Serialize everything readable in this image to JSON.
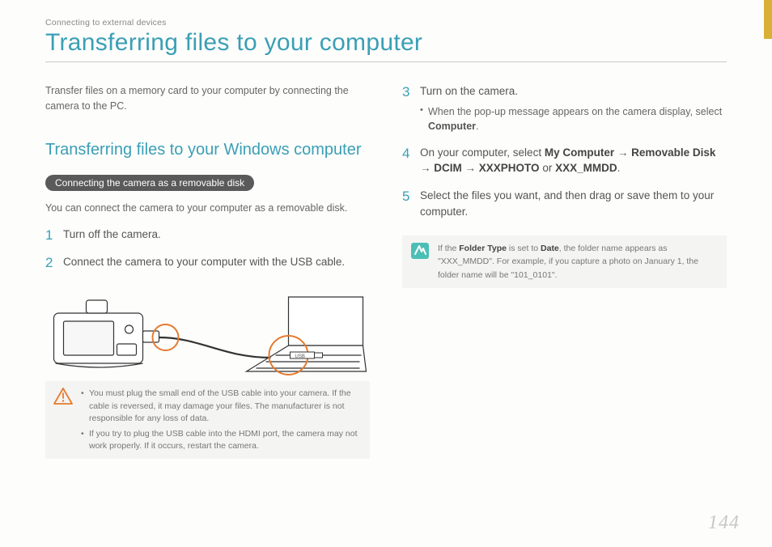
{
  "breadcrumb": "Connecting to external devices",
  "title": "Transferring files to your computer",
  "intro": "Transfer files on a memory card to your computer by connecting the camera to the PC.",
  "section_heading": "Transferring files to your Windows computer",
  "pill": "Connecting the camera as a removable disk",
  "lead": "You can connect the camera to your computer as a removable disk.",
  "steps": {
    "s1": {
      "num": "1",
      "text": "Turn off the camera."
    },
    "s2": {
      "num": "2",
      "text": "Connect the camera to your computer with the USB cable."
    },
    "s3": {
      "num": "3",
      "text": "Turn on the camera.",
      "sub_prefix": "When the pop-up message appears on the camera display, select ",
      "sub_bold": "Computer",
      "sub_suffix": "."
    },
    "s4": {
      "num": "4",
      "prefix": "On your computer, select ",
      "b1": "My Computer",
      "arrow1": " → ",
      "b2": "Removable Disk",
      "arrow2": " → ",
      "b3": "DCIM",
      "arrow3": " → ",
      "b4": "XXXPHOTO",
      "or": " or ",
      "b5": "XXX_MMDD",
      "suffix": "."
    },
    "s5": {
      "num": "5",
      "text": "Select the files you want, and then drag or save them to your computer."
    }
  },
  "warnings": {
    "w1": "You must plug the small end of the USB cable into your camera. If the cable is reversed, it may damage your files. The manufacturer is not responsible for any loss of data.",
    "w2": "If you try to plug the USB cable into the HDMI port, the camera may not work properly. If it occurs, restart the camera."
  },
  "note": {
    "p1": "If the ",
    "b1": "Folder Type",
    "p2": " is set to ",
    "b2": "Date",
    "p3": ", the folder name appears as \"XXX_MMDD\". For example, if you capture a photo on January 1, the folder name will be \"101_0101\"."
  },
  "page_number": "144"
}
